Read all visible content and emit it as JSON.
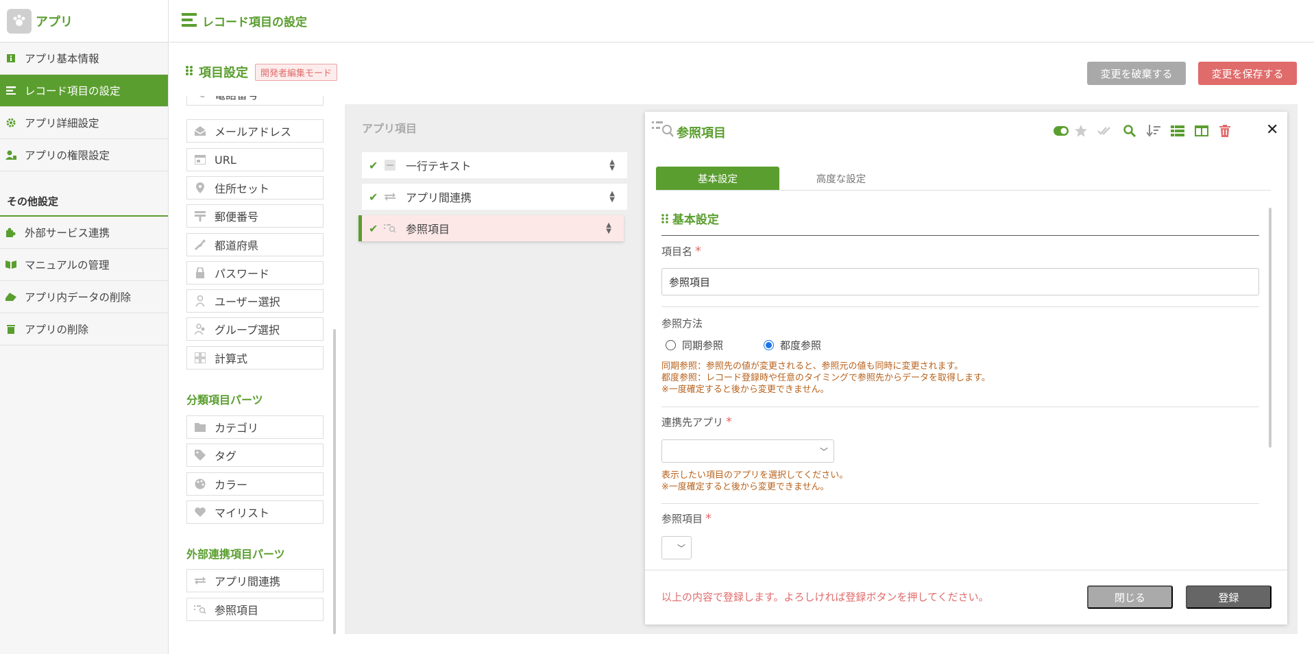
{
  "app": {
    "name": "アプリ"
  },
  "sidebar": {
    "items": [
      {
        "label": "アプリ基本情報",
        "icon": "info-icon"
      },
      {
        "label": "レコード項目の設定",
        "icon": "list-icon",
        "active": true
      },
      {
        "label": "アプリ詳細設定",
        "icon": "gear-icon"
      },
      {
        "label": "アプリの権限設定",
        "icon": "user-lock-icon"
      }
    ],
    "section_title": "その他設定",
    "other_items": [
      {
        "label": "外部サービス連携",
        "icon": "puzzle-icon"
      },
      {
        "label": "マニュアルの管理",
        "icon": "book-icon"
      },
      {
        "label": "アプリ内データの削除",
        "icon": "eraser-icon"
      },
      {
        "label": "アプリの削除",
        "icon": "trash-icon"
      }
    ]
  },
  "topbar": {
    "title": "レコード項目の設定"
  },
  "section": {
    "title": "項目設定",
    "badge": "開発者編集モード"
  },
  "buttons": {
    "discard": "変更を破棄する",
    "save": "変更を保存する"
  },
  "palette": {
    "partial_top": "電話番号",
    "basic_parts": [
      "メールアドレス",
      "URL",
      "住所セット",
      "郵便番号",
      "都道府県",
      "パスワード",
      "ユーザー選択",
      "グループ選択",
      "計算式"
    ],
    "category_heading": "分類項目パーツ",
    "category_parts": [
      "カテゴリ",
      "タグ",
      "カラー",
      "マイリスト"
    ],
    "external_heading": "外部連携項目パーツ",
    "external_parts": [
      "アプリ間連携",
      "参照項目"
    ]
  },
  "canvas": {
    "title": "アプリ項目",
    "fields": [
      "一行テキスト",
      "アプリ間連携",
      "参照項目"
    ]
  },
  "panel": {
    "title": "参照項目",
    "tabs": [
      "基本設定",
      "高度な設定"
    ],
    "section_heading": "基本設定",
    "name_label": "項目名",
    "name_value": "参照項目",
    "method_label": "参照方法",
    "method_options": [
      "同期参照",
      "都度参照"
    ],
    "method_selected": "都度参照",
    "method_notes": [
      "同期参照：参照先の値が変更されると、参照元の値も同時に変更されます。",
      "都度参照：レコード登録時や任意のタイミングで参照先からデータを取得します。",
      "※一度確定すると後から変更できません。"
    ],
    "target_app_label": "連携先アプリ",
    "target_app_notes": [
      "表示したい項目のアプリを選択してください。",
      "※一度確定すると後から変更できません。"
    ],
    "ref_field_label": "参照項目",
    "required_mark": "*",
    "footer_message": "以上の内容で登録します。よろしければ登録ボタンを押してください。",
    "close_label": "閉じる",
    "submit_label": "登録"
  },
  "colors": {
    "accent": "#5a9e2f",
    "danger": "#e06b6b",
    "muted": "#a9a9a9"
  }
}
